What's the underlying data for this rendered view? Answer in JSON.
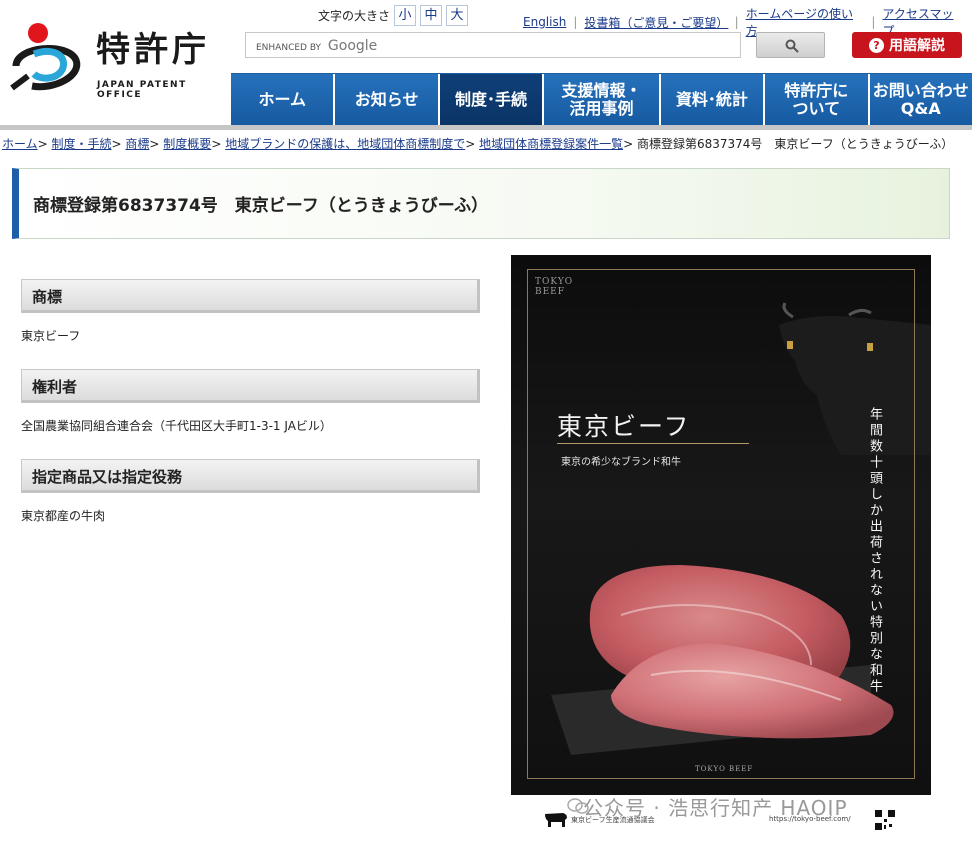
{
  "logo": {
    "name": "特許庁",
    "en": "JAPAN PATENT OFFICE"
  },
  "font_size": {
    "label": "文字の大きさ",
    "options": [
      "小",
      "中",
      "大"
    ]
  },
  "top_links": [
    "English",
    "投書箱（ご意見・ご要望）",
    "ホームページの使い方",
    "アクセスマップ"
  ],
  "search": {
    "placeholder_prefix": "ENHANCED BY",
    "placeholder_brand": "Google"
  },
  "glossary_button": "用語解説",
  "nav": [
    {
      "label": "ホーム"
    },
    {
      "label": "お知らせ"
    },
    {
      "label": "制度･手続",
      "active": true
    },
    {
      "label": "支援情報・活用事例"
    },
    {
      "label": "資料･統計"
    },
    {
      "label": "特許庁について"
    },
    {
      "label": "お問い合わせQ&A"
    }
  ],
  "breadcrumb": {
    "links": [
      "ホーム",
      "制度・手続",
      "商標",
      "制度概要",
      "地域ブランドの保護は、地域団体商標制度で",
      "地域団体商標登録案件一覧"
    ],
    "current": "商標登録第6837374号　東京ビーフ（とうきょうびーふ）"
  },
  "page_title": "商標登録第6837374号　東京ビーフ（とうきょうびーふ）",
  "sections": [
    {
      "heading": "商標",
      "value": "東京ビーフ"
    },
    {
      "heading": "権利者",
      "value": "全国農業協同組合連合会（千代田区大手町1-3-1 JAビル）"
    },
    {
      "heading": "指定商品又は指定役務",
      "value": "東京都産の牛肉"
    }
  ],
  "poster": {
    "corner_logo": "TOKYO BEEF",
    "main_text": "東京ビーフ",
    "sub_text": "東京の希少なブランド和牛",
    "vertical_text": "年間数十頭しか出荷されない特別な和牛",
    "bottom_text": "TOKYO BEEF",
    "footer_org": "東京ビーフ生産流通協議会",
    "footer_url": "https://tokyo-beef.com/"
  },
  "watermark": "公众号 · 浩思行知产 HAOIP",
  "colors": {
    "nav_blue": "#1f66ae",
    "nav_active": "#0c3a70",
    "glossary_red": "#c8141d",
    "title_accent": "#1d5ea8"
  }
}
